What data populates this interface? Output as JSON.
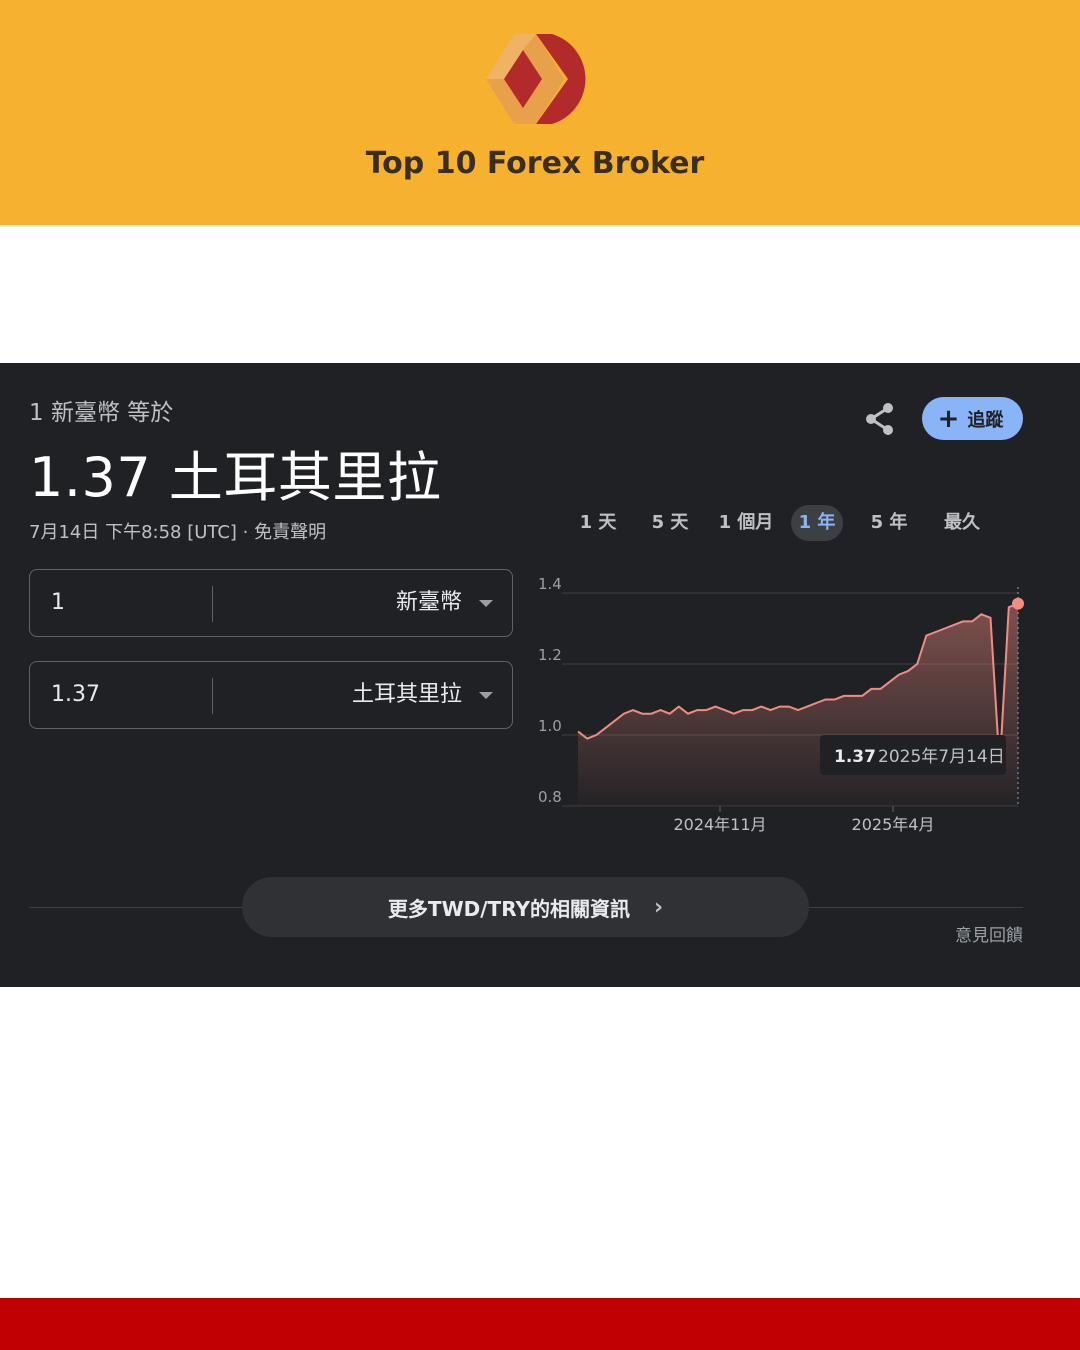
{
  "brand": {
    "title": "Top 10 Forex Broker",
    "colors": {
      "banner": "#f6b22f",
      "logo_gold": "#e8a04a",
      "logo_red": "#b32a2a",
      "footer": "#c00000"
    }
  },
  "converter": {
    "subtitle": "1 新臺幣 等於",
    "result": "1.37 土耳其里拉",
    "timestamp": "7月14日 下午8:58 [UTC] · 免責聲明",
    "share_icon": "share-icon",
    "track_label": "追蹤",
    "ranges": [
      {
        "label": "1 天",
        "active": false
      },
      {
        "label": "5 天",
        "active": false
      },
      {
        "label": "1 個月",
        "active": false
      },
      {
        "label": "1 年",
        "active": true
      },
      {
        "label": "5 年",
        "active": false
      },
      {
        "label": "最久",
        "active": false
      }
    ],
    "from": {
      "amount": "1",
      "currency": "新臺幣"
    },
    "to": {
      "amount": "1.37",
      "currency": "土耳其里拉"
    },
    "more_label": "更多TWD/TRY的相關資訊",
    "feedback": "意見回饋"
  },
  "chart_data": {
    "type": "area",
    "ylim": [
      0.8,
      1.4
    ],
    "yticks": [
      "0.8",
      "1.0",
      "1.2",
      "1.4"
    ],
    "xticks": [
      "2024年11月",
      "2025年4月"
    ],
    "line_color": "#f28b82",
    "series": [
      {
        "values": [
          1.01,
          0.99,
          1.0,
          1.02,
          1.04,
          1.06,
          1.07,
          1.06,
          1.06,
          1.07,
          1.06,
          1.08,
          1.06,
          1.07,
          1.07,
          1.08,
          1.07,
          1.06,
          1.07,
          1.07,
          1.08,
          1.07,
          1.08,
          1.08,
          1.07,
          1.08,
          1.09,
          1.1,
          1.1,
          1.11,
          1.11,
          1.11,
          1.13,
          1.13,
          1.15,
          1.17,
          1.18,
          1.2,
          1.28,
          1.29,
          1.3,
          1.31,
          1.32,
          1.32,
          1.34,
          1.33,
          0.91,
          1.36,
          1.37
        ]
      }
    ],
    "tooltip": {
      "value": "1.37",
      "date": "2025年7月14日"
    }
  }
}
